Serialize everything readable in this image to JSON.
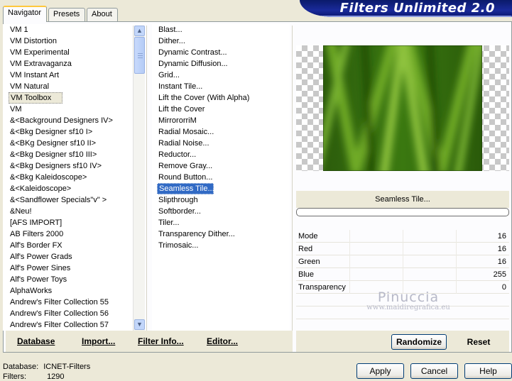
{
  "tabs": [
    "Navigator",
    "Presets",
    "About"
  ],
  "banner_title": "Filters Unlimited 2.0",
  "categories": [
    "VM 1",
    "VM Distortion",
    "VM Experimental",
    "VM Extravaganza",
    "VM Instant Art",
    "VM Natural",
    "VM Toolbox",
    "VM",
    "&<Background Designers IV>",
    "&<Bkg Designer sf10 I>",
    "&<BKg Designer sf10 II>",
    "&<Bkg Designer sf10 III>",
    "&<Bkg Designers sf10 IV>",
    "&<Bkg Kaleidoscope>",
    "&<Kaleidoscope>",
    "&<Sandflower Specials\"v\" >",
    "&Neu!",
    "[AFS IMPORT]",
    "AB Filters 2000",
    "Alf's Border FX",
    "Alf's Power Grads",
    "Alf's Power Sines",
    "Alf's Power Toys",
    "AlphaWorks",
    "Andrew's Filter Collection 55",
    "Andrew's Filter Collection 56",
    "Andrew's Filter Collection 57"
  ],
  "selected_category": "VM Toolbox",
  "filters": [
    "Blast...",
    "Dither...",
    "Dynamic Contrast...",
    "Dynamic Diffusion...",
    "Grid...",
    "Instant Tile...",
    "Lift the Cover (With Alpha)",
    "Lift the Cover",
    "MirrororriM",
    "Radial Mosaic...",
    "Radial Noise...",
    "Reductor...",
    "Remove Gray...",
    "Round Button...",
    "Seamless Tile...",
    "Slipthrough",
    "Softborder...",
    "Tiler...",
    "Transparency Dither...",
    "Trimosaic..."
  ],
  "selected_filter": "Seamless Tile...",
  "filter_name": "Seamless Tile...",
  "params": [
    {
      "label": "Mode",
      "value": "16"
    },
    {
      "label": "Red",
      "value": "16"
    },
    {
      "label": "Green",
      "value": "16"
    },
    {
      "label": "Blue",
      "value": "255"
    },
    {
      "label": "Transparency",
      "value": "0"
    }
  ],
  "watermark": {
    "name": "Pinuccia",
    "url": "www.maidiregrafica.eu"
  },
  "bottom_links": {
    "database": "Database",
    "import": "Import...",
    "filter_info": "Filter Info...",
    "editor": "Editor..."
  },
  "buttons": {
    "randomize": "Randomize",
    "reset": "Reset",
    "apply": "Apply",
    "cancel": "Cancel",
    "help": "Help"
  },
  "status": {
    "database_label": "Database:",
    "database_value": "ICNET-Filters",
    "filters_label": "Filters:",
    "filters_value": "1290"
  },
  "colors": {
    "selection": "#316ac5",
    "banner": "#1a2a9a",
    "preview_green": "#3c7a12"
  }
}
